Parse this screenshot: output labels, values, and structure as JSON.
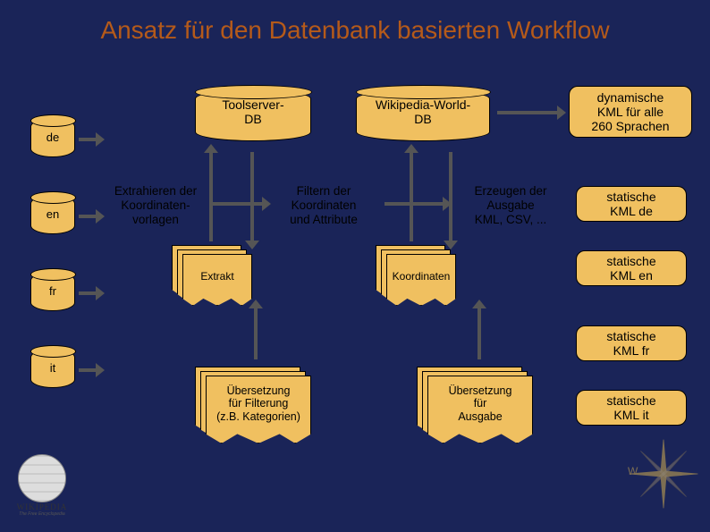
{
  "title": "Ansatz für den Datenbank basierten Workflow",
  "langs": {
    "de": "de",
    "en": "en",
    "fr": "fr",
    "it": "it"
  },
  "db": {
    "toolserver": "Toolserver-\nDB",
    "wikipedia": "Wikipedia-World-\nDB"
  },
  "process": {
    "extract": "Extrahieren der\nKoordinaten-\nvorlagen",
    "filter": "Filtern der\nKoordinaten\nund Attribute",
    "generate": "Erzeugen der\nAusgabe\nKML, CSV, ..."
  },
  "docs": {
    "extrakt": "Extrakt",
    "koordinaten": "Koordinaten",
    "trans_filter": "Übersetzung\nfür Filterung\n(z.B. Kategorien)",
    "trans_output": "Übersetzung\nfür\nAusgabe"
  },
  "outputs": {
    "dynamic": "dynamische\nKML für alle\n260 Sprachen",
    "de": "statische\nKML de",
    "en": "statische\nKML en",
    "fr": "statische\nKML fr",
    "it": "statische\nKML it"
  },
  "logo": {
    "title": "WIKIPEDIA",
    "sub": "The Free Encyclopedia"
  },
  "compass": {
    "w": "W"
  }
}
